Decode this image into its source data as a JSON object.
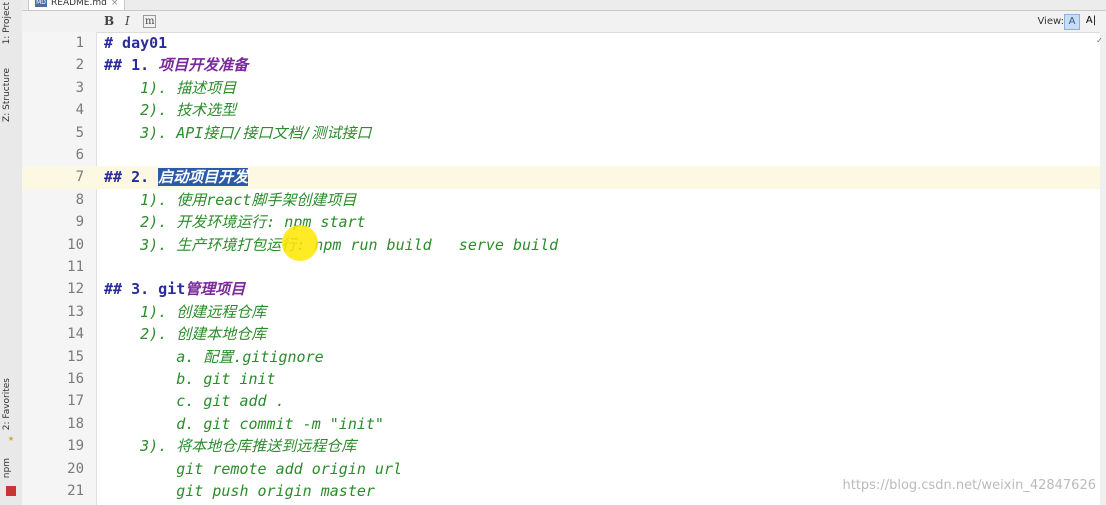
{
  "left_panel": {
    "tabs": [
      {
        "label": "1: Project"
      },
      {
        "label": "Z: Structure"
      },
      {
        "label": "2: Favorites"
      },
      {
        "label": "npm"
      }
    ]
  },
  "editor_tab": {
    "filename": "README.md",
    "icon": "md-file-icon"
  },
  "toolbar": {
    "bold": "B",
    "italic": "I",
    "code": "m",
    "view_label": "View:",
    "view_options": [
      "A",
      "A|",
      "|"
    ]
  },
  "lines": [
    {
      "n": "1",
      "segments": [
        {
          "t": "# day01",
          "c": "h"
        }
      ]
    },
    {
      "n": "2",
      "segments": [
        {
          "t": "## 1. ",
          "c": "h"
        },
        {
          "t": "项目开发准备",
          "c": "purple"
        }
      ]
    },
    {
      "n": "3",
      "segments": [
        {
          "t": "    1). ",
          "c": "it"
        },
        {
          "t": "描述项目",
          "c": "it"
        }
      ]
    },
    {
      "n": "4",
      "segments": [
        {
          "t": "    2). ",
          "c": "it"
        },
        {
          "t": "技术选型",
          "c": "it"
        }
      ]
    },
    {
      "n": "5",
      "segments": [
        {
          "t": "    3). API",
          "c": "it"
        },
        {
          "t": "接口/接口文档/测试接口",
          "c": "it"
        }
      ]
    },
    {
      "n": "6",
      "segments": []
    },
    {
      "n": "7",
      "segments": [
        {
          "t": "## 2. ",
          "c": "h"
        },
        {
          "t": "启动项目开发",
          "c": "purple sel"
        }
      ],
      "current": true
    },
    {
      "n": "8",
      "segments": [
        {
          "t": "    1). ",
          "c": "it"
        },
        {
          "t": "使用react脚手架创建项目",
          "c": "it"
        }
      ]
    },
    {
      "n": "9",
      "segments": [
        {
          "t": "    2). ",
          "c": "it"
        },
        {
          "t": "开发环境运行: npm start",
          "c": "it"
        }
      ]
    },
    {
      "n": "10",
      "segments": [
        {
          "t": "    3). ",
          "c": "it"
        },
        {
          "t": "生产环境打包运行: npm run build   serve build",
          "c": "it"
        }
      ]
    },
    {
      "n": "11",
      "segments": []
    },
    {
      "n": "12",
      "segments": [
        {
          "t": "## 3. git",
          "c": "h"
        },
        {
          "t": "管理项目",
          "c": "purple"
        }
      ]
    },
    {
      "n": "13",
      "segments": [
        {
          "t": "    1). ",
          "c": "it"
        },
        {
          "t": "创建远程仓库",
          "c": "it"
        }
      ]
    },
    {
      "n": "14",
      "segments": [
        {
          "t": "    2). ",
          "c": "it"
        },
        {
          "t": "创建本地仓库",
          "c": "it"
        }
      ]
    },
    {
      "n": "15",
      "segments": [
        {
          "t": "        a. ",
          "c": "it"
        },
        {
          "t": "配置.gitignore",
          "c": "it"
        }
      ]
    },
    {
      "n": "16",
      "segments": [
        {
          "t": "        b. git init",
          "c": "it"
        }
      ]
    },
    {
      "n": "17",
      "segments": [
        {
          "t": "        c. git add .",
          "c": "it"
        }
      ]
    },
    {
      "n": "18",
      "segments": [
        {
          "t": "        d. git commit -m \"init\"",
          "c": "it"
        }
      ]
    },
    {
      "n": "19",
      "segments": [
        {
          "t": "    3). ",
          "c": "it"
        },
        {
          "t": "将本地仓库推送到远程仓库",
          "c": "it"
        }
      ]
    },
    {
      "n": "20",
      "segments": [
        {
          "t": "        git remote add origin url",
          "c": "it"
        }
      ]
    },
    {
      "n": "21",
      "segments": [
        {
          "t": "        git push origin master",
          "c": "it"
        }
      ]
    }
  ],
  "watermark": "https://blog.csdn.net/weixin_42847626"
}
